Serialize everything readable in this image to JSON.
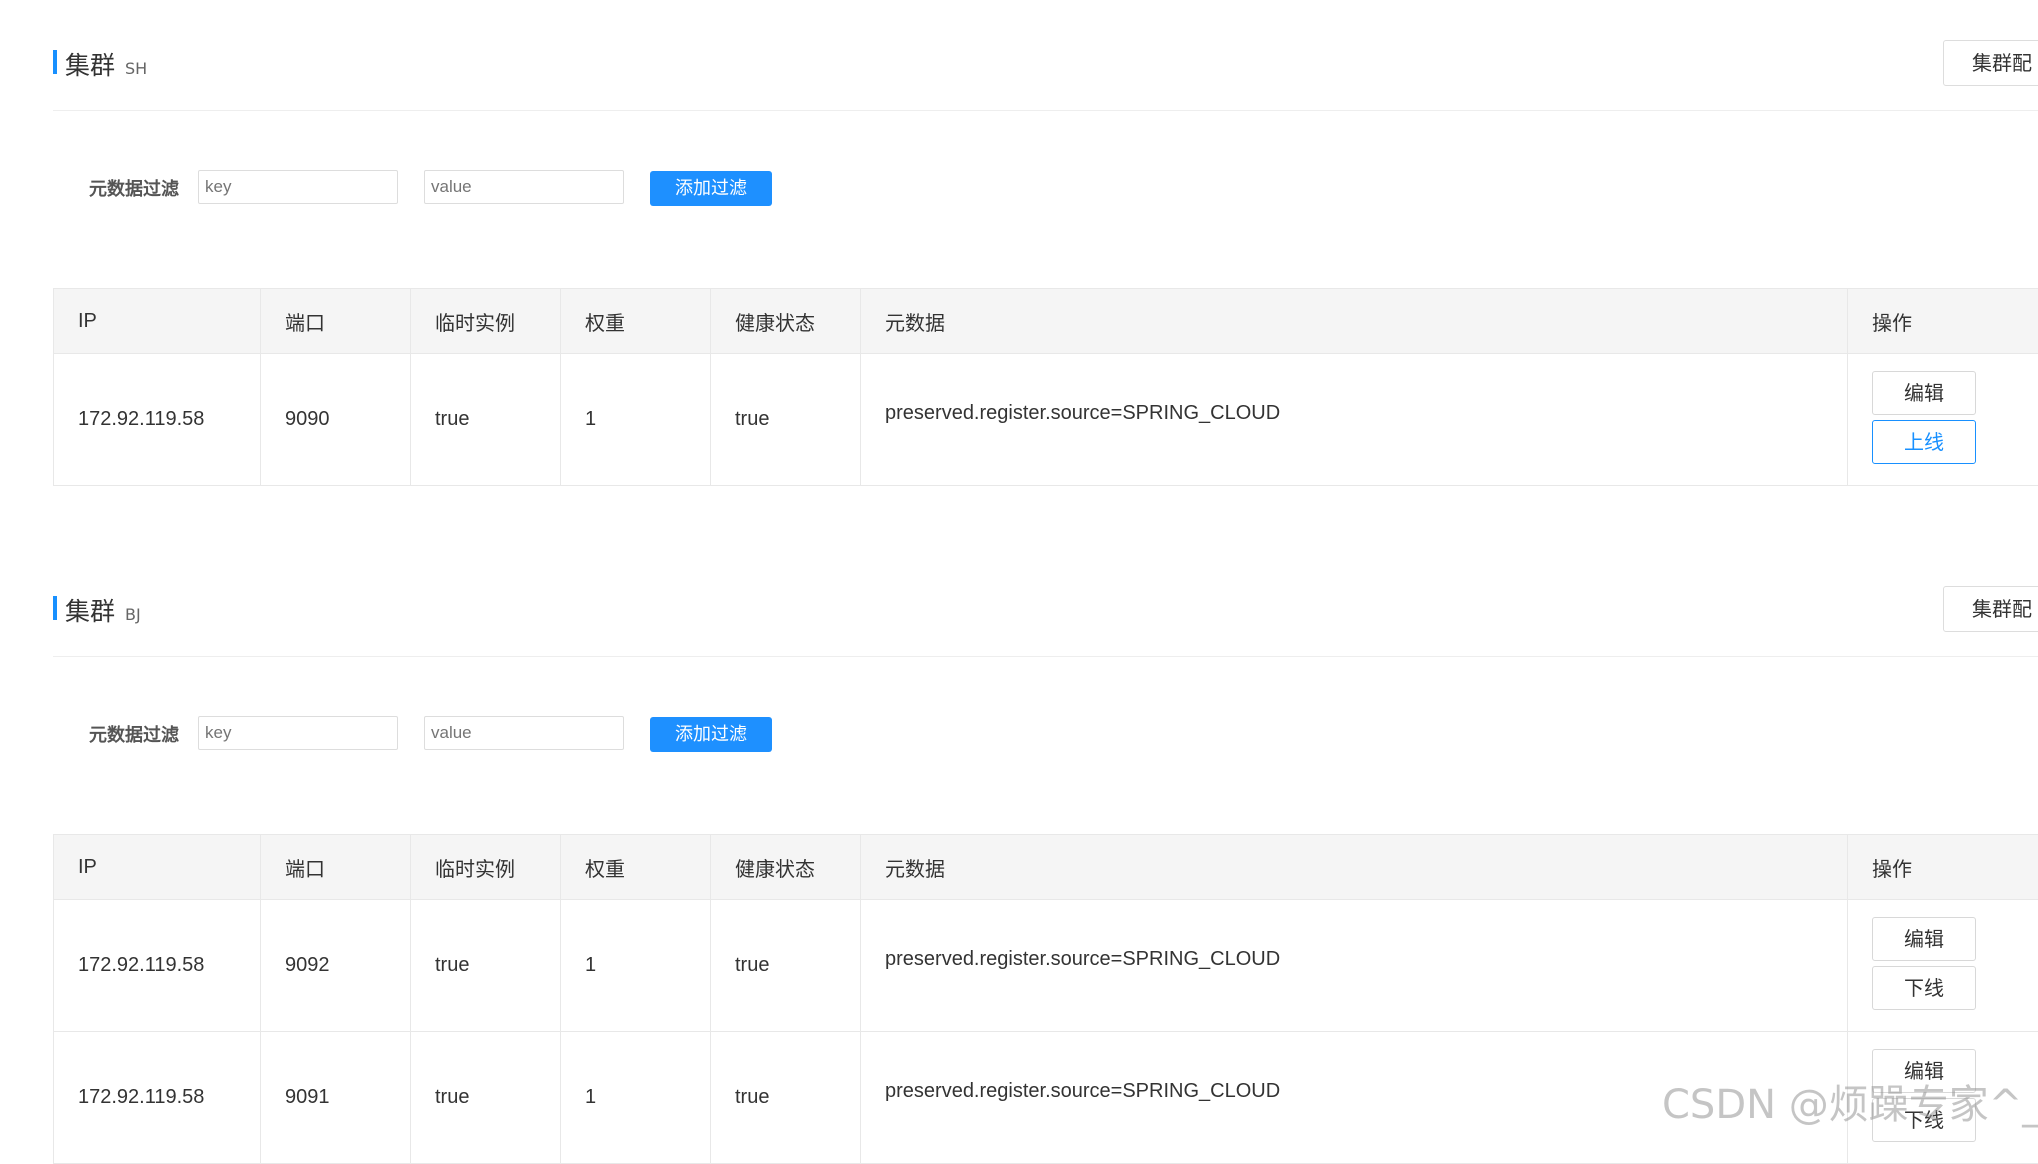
{
  "clusters": [
    {
      "title": "集群",
      "name": "SH",
      "config_button": "集群配",
      "filter": {
        "label": "元数据过滤",
        "key_placeholder": "key",
        "value_placeholder": "value",
        "add_button": "添加过滤"
      },
      "columns": [
        "IP",
        "端口",
        "临时实例",
        "权重",
        "健康状态",
        "元数据",
        "操作"
      ],
      "rows": [
        {
          "ip": "172.92.119.58",
          "port": "9090",
          "ephemeral": "true",
          "weight": "1",
          "healthy": "true",
          "metadata": "preserved.register.source=SPRING_CLOUD",
          "edit": "编辑",
          "toggle": "上线"
        }
      ]
    },
    {
      "title": "集群",
      "name": "BJ",
      "config_button": "集群配",
      "filter": {
        "label": "元数据过滤",
        "key_placeholder": "key",
        "value_placeholder": "value",
        "add_button": "添加过滤"
      },
      "columns": [
        "IP",
        "端口",
        "临时实例",
        "权重",
        "健康状态",
        "元数据",
        "操作"
      ],
      "rows": [
        {
          "ip": "172.92.119.58",
          "port": "9092",
          "ephemeral": "true",
          "weight": "1",
          "healthy": "true",
          "metadata": "preserved.register.source=SPRING_CLOUD",
          "edit": "编辑",
          "toggle": "下线"
        },
        {
          "ip": "172.92.119.58",
          "port": "9091",
          "ephemeral": "true",
          "weight": "1",
          "healthy": "true",
          "metadata": "preserved.register.source=SPRING_CLOUD",
          "edit": "编辑",
          "toggle": "下线"
        }
      ]
    }
  ],
  "watermark": "CSDN @烦躁专家^_^",
  "colors": {
    "accent": "#1890ff",
    "header_bg": "#f5f5f5",
    "border": "#e8e8e8"
  }
}
